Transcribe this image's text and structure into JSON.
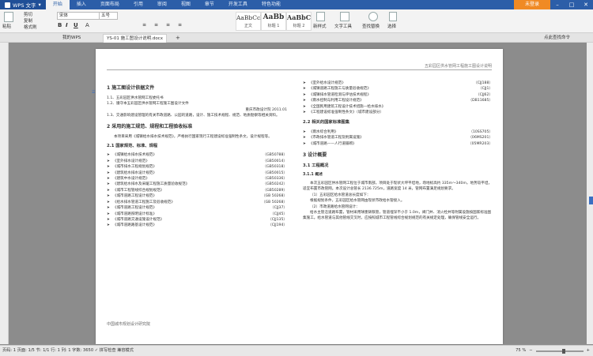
{
  "app": {
    "name": "WPS 文字",
    "login": "未登录"
  },
  "menu": [
    "开始",
    "插入",
    "页面布局",
    "引用",
    "审阅",
    "视图",
    "章节",
    "开发工具",
    "特色功能"
  ],
  "ribbon": {
    "paste": "粘贴",
    "cut": "剪切",
    "copy": "复制",
    "format_painter": "格式刷",
    "font": "宋体",
    "size": "五号",
    "styles": [
      {
        "sample": "AaBbCcI",
        "label": "正文"
      },
      {
        "sample": "AaBb",
        "label": "标题 1"
      },
      {
        "sample": "AaBbC",
        "label": "标题 2"
      }
    ],
    "new_style": "新样式",
    "text_tools": "文字工具",
    "find_replace": "查找替换",
    "select": "选择"
  },
  "tabs": {
    "home": "我的WPS",
    "doc": "YS-01 施工图设计说明.docx"
  },
  "search": "点此查找命令",
  "page": {
    "header": "五彩园区供水管网工程施工图设计说明",
    "footer": "中国城市规划设计研究院",
    "left": {
      "s1_title": "1  施工图设计依据文件",
      "s1_items": [
        "1.1、五彩园区供水管网工程委托书",
        "1.2、遵守本五彩园区供水管网工程施工图设计文件",
        "1.3、交通影响建设管理的有关市政道路、公园的道路，设计、施工技术规程、规范、地质勘察等相关资料。"
      ],
      "date_line": "重庆市政设计院 2011.01",
      "s2_title": "2  采用的施工规范、规程和工程验收标准",
      "s2_text": "本项目采用《城镇给水排水技术规范》，严格执行国家现行工程建设标准强制性条文，设计规程等。",
      "s21_title": "2.1  国家规范、标准、规程",
      "s21_items": [
        {
          "n": "《城镇给水排水技术规范》",
          "c": "（GB50788）"
        },
        {
          "n": "《室外排水设计规范》",
          "c": "（GB50014）"
        },
        {
          "n": "《城市排水工程规划规范》",
          "c": "（GB50318）"
        },
        {
          "n": "《建筑给水排水设计规范》",
          "c": "（GB50015）"
        },
        {
          "n": "《建筑中水设计规范》",
          "c": "（GB50336）"
        },
        {
          "n": "《建筑给水排水及采暖工程施工质量验收规范》",
          "c": "（GB50242）"
        },
        {
          "n": "《城市工程管线综合规划规范》",
          "c": "（GB50289）"
        },
        {
          "n": "《城市道路工程设计规范》",
          "c": "（GB 50268）"
        },
        {
          "n": "《给水排水管道工程施工及验收规范》",
          "c": "（GB 50268）"
        },
        {
          "n": "《城市道路工程设计规范》",
          "c": "（CJJ37）"
        },
        {
          "n": "《城市道路照明设计标准》",
          "c": "（CJJ45）"
        },
        {
          "n": "《城市道路交通设施设计规范》",
          "c": "（CJJ135）"
        },
        {
          "n": "《城市道路路基设计规范》",
          "c": "（CJJ194）"
        }
      ]
    },
    "right": {
      "top_items": [
        {
          "n": "《室外给水设计规范》",
          "c": "（CJJ188）"
        },
        {
          "n": "《城镇道路工程施工与质量验收规范》",
          "c": "（CJJ1）"
        },
        {
          "n": "《城镇排水管道检测与评估技术规程》",
          "c": "（CJJ62）"
        },
        {
          "n": "《雨水控制与利用工程设计规范》",
          "c": "（DB11685）"
        },
        {
          "n": "《全国民用建筑工程设计技术措施—给水排水》",
          "c": ""
        },
        {
          "n": "《工程建设标准强制性条文》（城市建设部分）",
          "c": ""
        }
      ],
      "s22_title": "2.2  相关的国家标准图集",
      "s22_items": [
        {
          "n": "《雨水综合利用》",
          "c": "（10SS705）"
        },
        {
          "n": "《市政排水管道工程及附属设施》",
          "c": "（06MS201）"
        },
        {
          "n": "《城市道路——人行道铺砌》",
          "c": "（05MR203）"
        }
      ],
      "s3_title": "3  设计概要",
      "s31_title": "3.1  工程概况",
      "s311_title": "3.1.1  概述",
      "p1": "本次五彩园区供水管网工程位于城市南部，项目处于现状大坪平坦地，场地标高约 335m～340m，地势较平坦，适宜布置市政管网。本次设计总管长 2136.725m，道路宽度 14 米，管网布置满足规划要求。",
      "p1b": "（1）五彩园区给水管道总长度如下：",
      "p2": "根据规划条件，五彩园区给水管网由现状市政给水管接入。",
      "p3": "（2）市政道路给水管网设计：",
      "p4": "给水主管沿道路布置，管材采用球墨铸铁管，管道埋深不小于 1.0m，阀门井、消火栓井等附属设施按国家标准图集施工。给水管道与其他管线交叉时，应按照城市工程管线综合规划规范的有关规定处理，确保管线安全运行。"
    }
  },
  "status": {
    "left": "页码: 1  页面: 1/5  节: 1/1  行: 1  列: 1  字数: 3650  ✓ 拼写检查  兼容模式",
    "zoom": "75 %"
  }
}
